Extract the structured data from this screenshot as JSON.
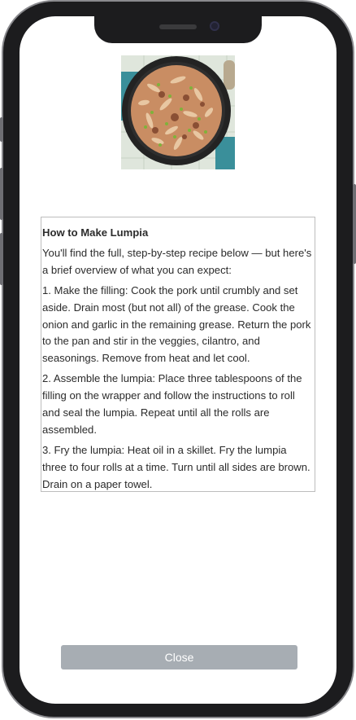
{
  "recipe": {
    "image_alt": "Skillet of pasta with ground pork and herbs",
    "heading": "How to Make Lumpia",
    "intro": "You'll find the full, step-by-step recipe below — but here's a brief overview of what you can expect:",
    "steps": [
      "1. Make the filling: Cook the pork until crumbly and set aside. Drain most (but not all) of the grease. Cook the onion and garlic in the remaining grease. Return the pork to the pan and stir in the veggies, cilantro, and seasonings. Remove from heat and let cool.",
      "2. Assemble the lumpia: Place three tablespoons of the filling on the wrapper and follow the instructions to roll and seal the lumpia. Repeat until all the rolls are assembled.",
      "3. Fry the lumpia: Heat oil in a skillet. Fry the lumpia three to four rolls at a time. Turn until all sides are brown. Drain on a paper towel."
    ]
  },
  "footer": {
    "close_label": "Close"
  },
  "colors": {
    "close_button_bg": "#a7adb3",
    "box_border": "#bdbdbd",
    "text": "#2b2b2b"
  }
}
